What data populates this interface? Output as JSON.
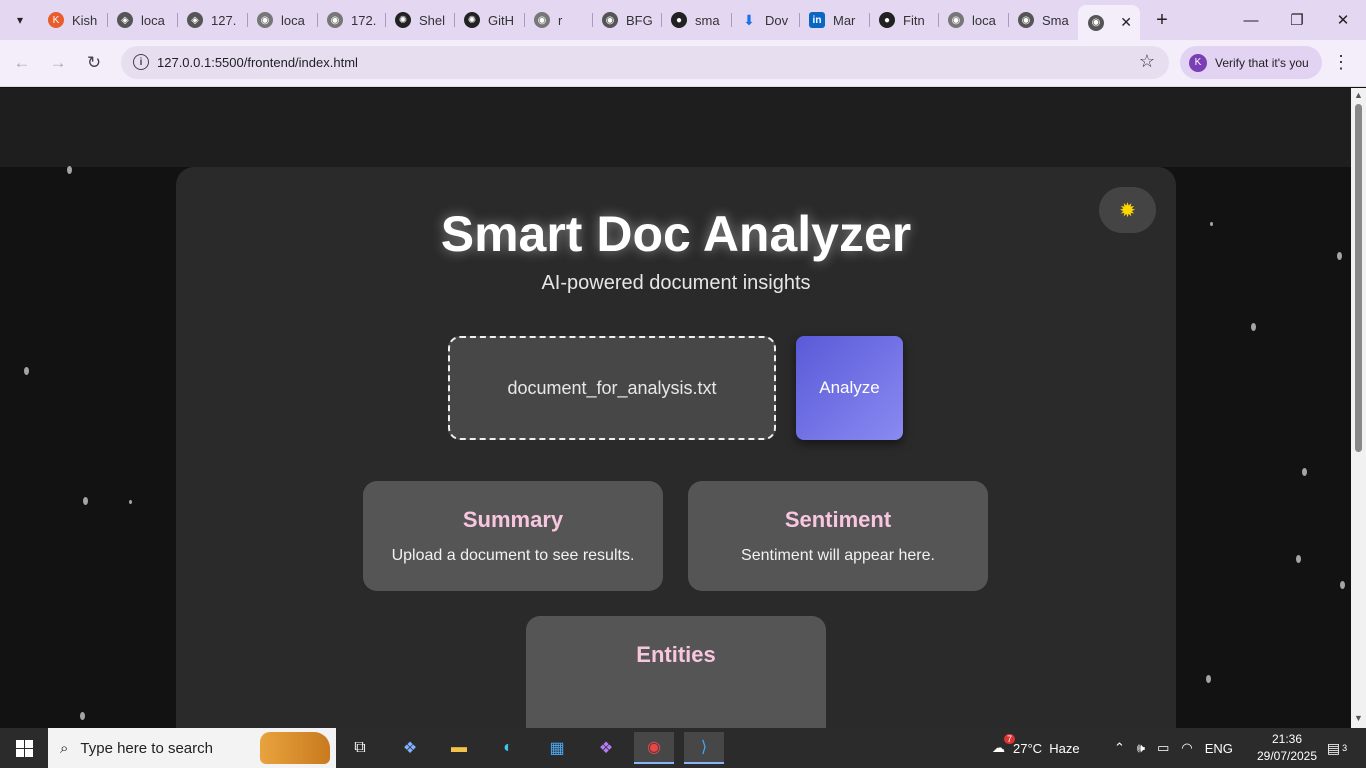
{
  "browser": {
    "tabs": [
      {
        "label": "Kish",
        "icon": "k-logo-icon",
        "color": "#e85d2b"
      },
      {
        "label": "loca",
        "icon": "compass-icon",
        "color": "#555555"
      },
      {
        "label": "127.",
        "icon": "compass-icon",
        "color": "#555555"
      },
      {
        "label": "loca",
        "icon": "globe-icon",
        "color": "#777777"
      },
      {
        "label": "172.",
        "icon": "globe-icon",
        "color": "#777777"
      },
      {
        "label": "Shel",
        "icon": "openai-icon",
        "color": "#222222"
      },
      {
        "label": "GitH",
        "icon": "openai-icon",
        "color": "#222222"
      },
      {
        "label": "r",
        "icon": "globe-icon",
        "color": "#777777"
      },
      {
        "label": "BFG",
        "icon": "globe-icon",
        "color": "#555555"
      },
      {
        "label": "sma",
        "icon": "github-icon",
        "color": "#222222"
      },
      {
        "label": "Dov",
        "icon": "download-icon",
        "color": "#1a73e8"
      },
      {
        "label": "Mar",
        "icon": "linkedin-icon",
        "color": "#0a66c2"
      },
      {
        "label": "Fitn",
        "icon": "github-icon",
        "color": "#222222"
      },
      {
        "label": "loca",
        "icon": "globe-icon",
        "color": "#777777"
      },
      {
        "label": "Sma",
        "icon": "globe-icon",
        "color": "#555555"
      }
    ],
    "address": "127.0.0.1:5500/frontend/index.html",
    "profile_label": "Verify that it's you",
    "profile_initial": "K",
    "window_controls": {
      "minimize": "—",
      "restore": "❐",
      "close": "✕"
    }
  },
  "app": {
    "title": "Smart Doc Analyzer",
    "subtitle": "AI-powered document insights",
    "theme_toggle_icon": "sun-icon",
    "file_name": "document_for_analysis.txt",
    "analyze_label": "Analyze",
    "cards": [
      {
        "title": "Summary",
        "body": "Upload a document to see results."
      },
      {
        "title": "Sentiment",
        "body": "Sentiment will appear here."
      },
      {
        "title": "Entities",
        "body": ""
      }
    ],
    "colors": {
      "card_title": "#f8c7df",
      "button_gradient_start": "#5a5ad8",
      "button_gradient_end": "#8a8af2",
      "background": "#121212"
    }
  },
  "taskbar": {
    "search_placeholder": "Type here to search",
    "weather_badge": "7",
    "weather": "27°C  Haze",
    "language": "ENG",
    "time": "21:36",
    "date": "29/07/2025",
    "notification_count": "3"
  }
}
